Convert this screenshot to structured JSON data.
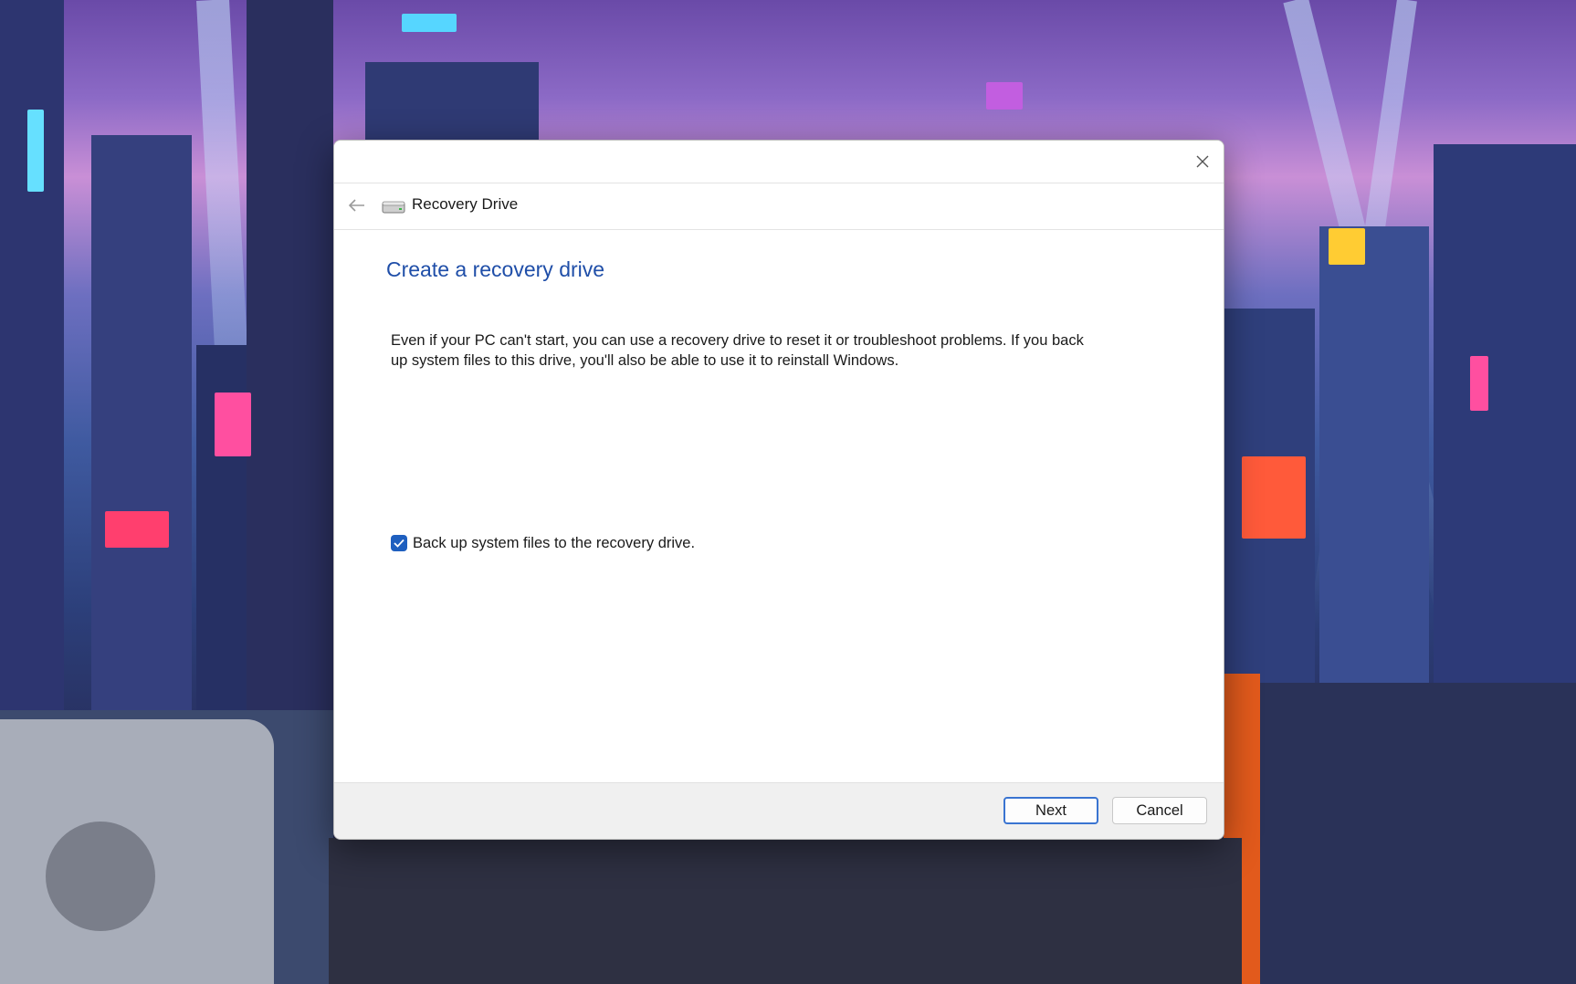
{
  "window": {
    "title": "Recovery Drive",
    "close_icon": "close-icon",
    "back_icon": "back-arrow-icon",
    "drive_icon": "drive-icon"
  },
  "content": {
    "heading": "Create a recovery drive",
    "description": "Even if your PC can't start, you can use a recovery drive to reset it or troubleshoot problems. If you back up system files to this drive, you'll also be able to use it to reinstall Windows.",
    "checkbox": {
      "label": "Back up system files to the recovery drive.",
      "checked": true
    }
  },
  "footer": {
    "next_label": "Next",
    "cancel_label": "Cancel"
  },
  "colors": {
    "heading": "#1f4ea8",
    "accent": "#1e5fbf",
    "footer_bg": "#f0f0f0"
  }
}
